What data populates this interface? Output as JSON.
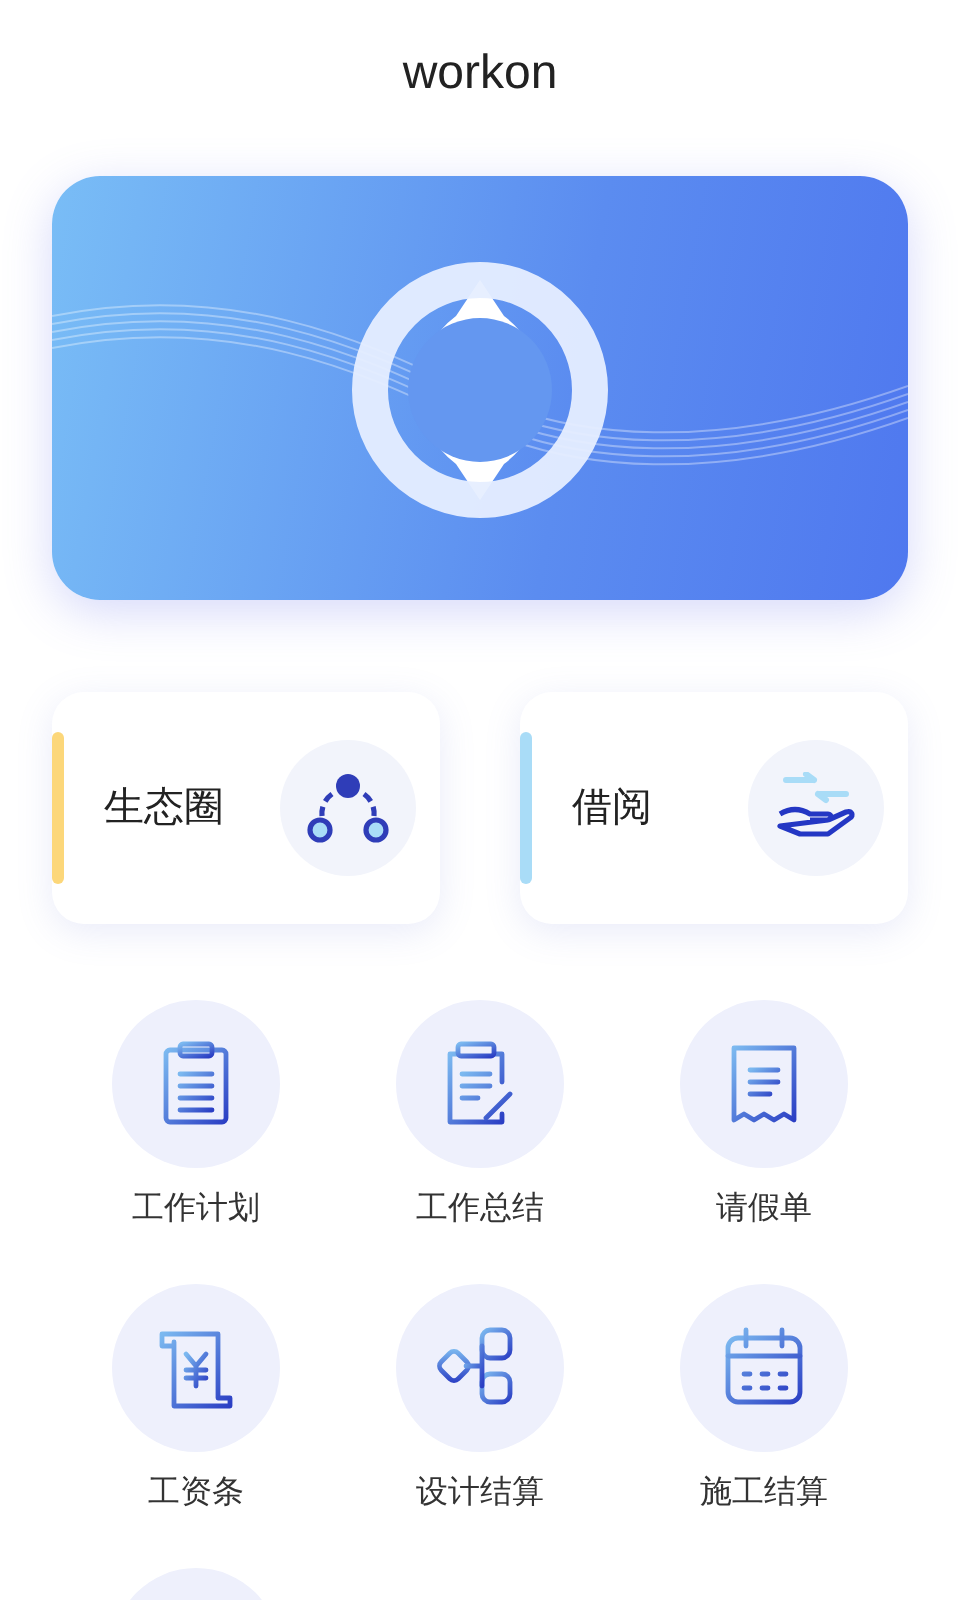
{
  "header": {
    "title": "workon"
  },
  "shortcuts": [
    {
      "label": "生态圈",
      "color": "#fcd77a",
      "kind": "network"
    },
    {
      "label": "借阅",
      "color": "#a9dcf7",
      "kind": "lend"
    }
  ],
  "grid": [
    {
      "label": "工作计划",
      "kind": "clipboard"
    },
    {
      "label": "工作总结",
      "kind": "edit"
    },
    {
      "label": "请假单",
      "kind": "receipt"
    },
    {
      "label": "工资条",
      "kind": "payslip"
    },
    {
      "label": "设计结算",
      "kind": "flow"
    },
    {
      "label": "施工结算",
      "kind": "calendar"
    }
  ]
}
